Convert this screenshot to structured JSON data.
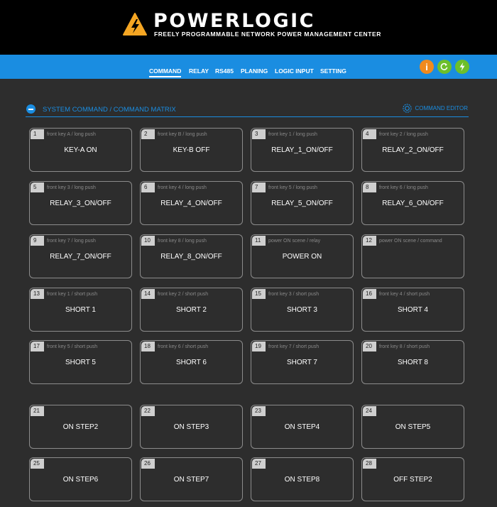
{
  "header": {
    "brand": "POWERLOGIC",
    "tagline": "FREELY PROGRAMMABLE NETWORK POWER MANAGEMENT CENTER"
  },
  "nav": {
    "items": [
      "COMMAND",
      "RELAY",
      "RS485",
      "PLANING",
      "LOGIC INPUT",
      "SETTING"
    ],
    "active": "COMMAND",
    "buttons": [
      {
        "icon": "info-icon",
        "glyph": "i",
        "color": "#f08a1e"
      },
      {
        "icon": "refresh-icon",
        "glyph": "c",
        "color": "#6dbf2a"
      },
      {
        "icon": "power-bolt-icon",
        "glyph": "",
        "color": "#6dbf2a"
      }
    ]
  },
  "section": {
    "title": "SYSTEM COMMAND / COMMAND MATRIX",
    "editor_label": "COMMAND EDITOR"
  },
  "commands": [
    {
      "num": "1",
      "hint": "front key A / long push",
      "label": "KEY-A ON"
    },
    {
      "num": "2",
      "hint": "front key B / long push",
      "label": "KEY-B OFF"
    },
    {
      "num": "3",
      "hint": "front key 1 / long push",
      "label": "RELAY_1_ON/OFF"
    },
    {
      "num": "4",
      "hint": "front key 2 / long push",
      "label": "RELAY_2_ON/OFF"
    },
    {
      "num": "5",
      "hint": "front key 3 / long push",
      "label": "RELAY_3_ON/OFF"
    },
    {
      "num": "6",
      "hint": "front key 4 / long push",
      "label": "RELAY_4_ON/OFF"
    },
    {
      "num": "7",
      "hint": "front key 5 / long push",
      "label": "RELAY_5_ON/OFF"
    },
    {
      "num": "8",
      "hint": "front key 6 / long push",
      "label": "RELAY_6_ON/OFF"
    },
    {
      "num": "9",
      "hint": "front key 7 / long push",
      "label": "RELAY_7_ON/OFF"
    },
    {
      "num": "10",
      "hint": "front key 8 / long push",
      "label": "RELAY_8_ON/OFF"
    },
    {
      "num": "11",
      "hint": "power ON scene / relay",
      "label": "POWER ON"
    },
    {
      "num": "12",
      "hint": "power ON scene / command",
      "label": ""
    },
    {
      "num": "13",
      "hint": "front key 1 / short push",
      "label": "SHORT 1"
    },
    {
      "num": "14",
      "hint": "front key 2 / short push",
      "label": "SHORT 2"
    },
    {
      "num": "15",
      "hint": "front key 3 / short push",
      "label": "SHORT 3"
    },
    {
      "num": "16",
      "hint": "front key 4 / short push",
      "label": "SHORT 4"
    },
    {
      "num": "17",
      "hint": "front key 5 / short push",
      "label": "SHORT 5"
    },
    {
      "num": "18",
      "hint": "front key 6 / short push",
      "label": "SHORT 6"
    },
    {
      "num": "19",
      "hint": "front key 7 / short push",
      "label": "SHORT 7"
    },
    {
      "num": "20",
      "hint": "front key 8 / short push",
      "label": "SHORT 8"
    },
    {
      "num": "21",
      "hint": "",
      "label": "ON STEP2"
    },
    {
      "num": "22",
      "hint": "",
      "label": "ON STEP3"
    },
    {
      "num": "23",
      "hint": "",
      "label": "ON STEP4"
    },
    {
      "num": "24",
      "hint": "",
      "label": "ON STEP5"
    },
    {
      "num": "25",
      "hint": "",
      "label": "ON STEP6"
    },
    {
      "num": "26",
      "hint": "",
      "label": "ON STEP7"
    },
    {
      "num": "27",
      "hint": "",
      "label": "ON STEP8"
    },
    {
      "num": "28",
      "hint": "",
      "label": "OFF STEP2"
    }
  ],
  "colors": {
    "accent": "#1a8de1",
    "background": "#2d2d2d",
    "header": "#000000",
    "logo_warning": "#f5a623"
  }
}
